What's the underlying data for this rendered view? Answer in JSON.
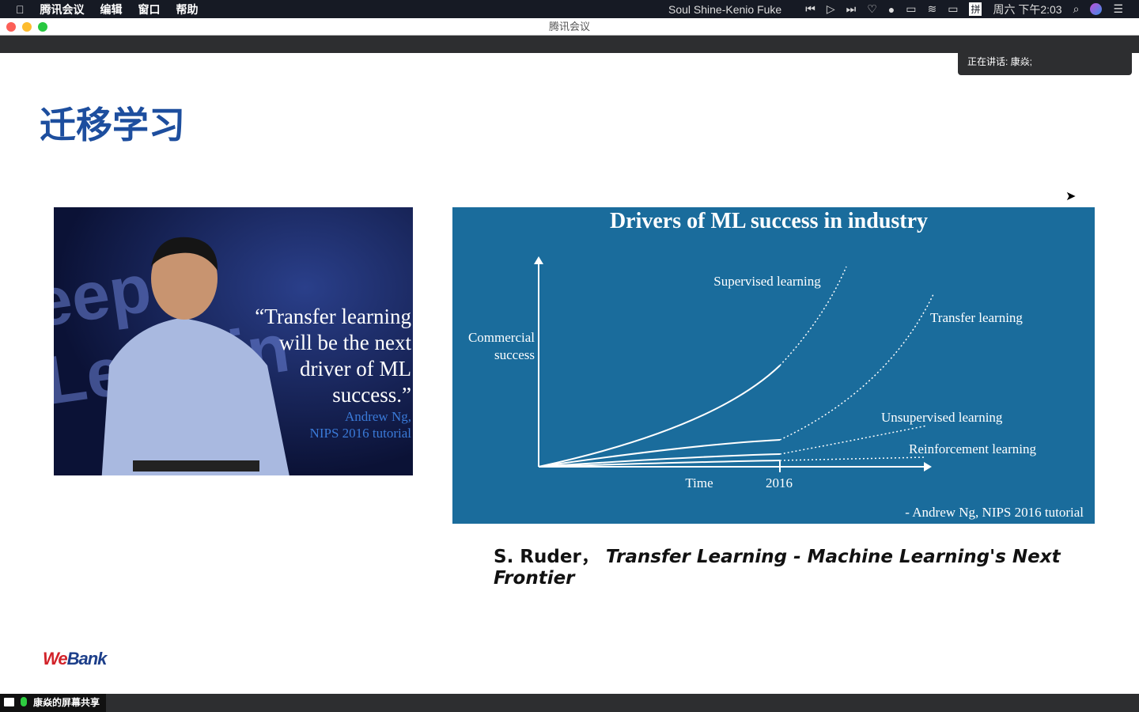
{
  "menubar": {
    "app": "腾讯会议",
    "items": [
      "编辑",
      "窗口",
      "帮助"
    ],
    "now_playing": "Soul Shine-Kenio Fuke",
    "clock": "周六 下午2:03",
    "input_method": "拼"
  },
  "window": {
    "title": "腾讯会议"
  },
  "speaker": {
    "label": "正在讲话: 康焱;"
  },
  "slide": {
    "title": "迁移学习",
    "photo": {
      "bg_text": "eep Learnin",
      "quote": [
        "“Transfer learning",
        "will be the next",
        "driver of ML",
        "success.”"
      ],
      "attribution": [
        "Andrew Ng,",
        "NIPS 2016 tutorial"
      ]
    },
    "chart": {
      "title": "Drivers of ML success in industry",
      "ylabel": [
        "Commercial",
        "success"
      ],
      "xlabel": "Time",
      "x_tick": "2016",
      "series": [
        "Supervised learning",
        "Transfer learning",
        "Unsupervised learning",
        "Reinforcement learning"
      ],
      "source": "- Andrew Ng, NIPS 2016 tutorial"
    },
    "caption": {
      "author": "S. Ruder，",
      "title": "Transfer Learning - Machine Learning's Next Frontier"
    },
    "logo": {
      "we": "We",
      "bank": "Bank"
    }
  },
  "bottombar": {
    "share_label": "康焱的屏幕共享"
  },
  "colors": {
    "title_blue": "#1d4e9e",
    "chart_bg": "#1a6c9c",
    "logo_red": "#d2232a",
    "logo_blue": "#1d3f8a"
  }
}
